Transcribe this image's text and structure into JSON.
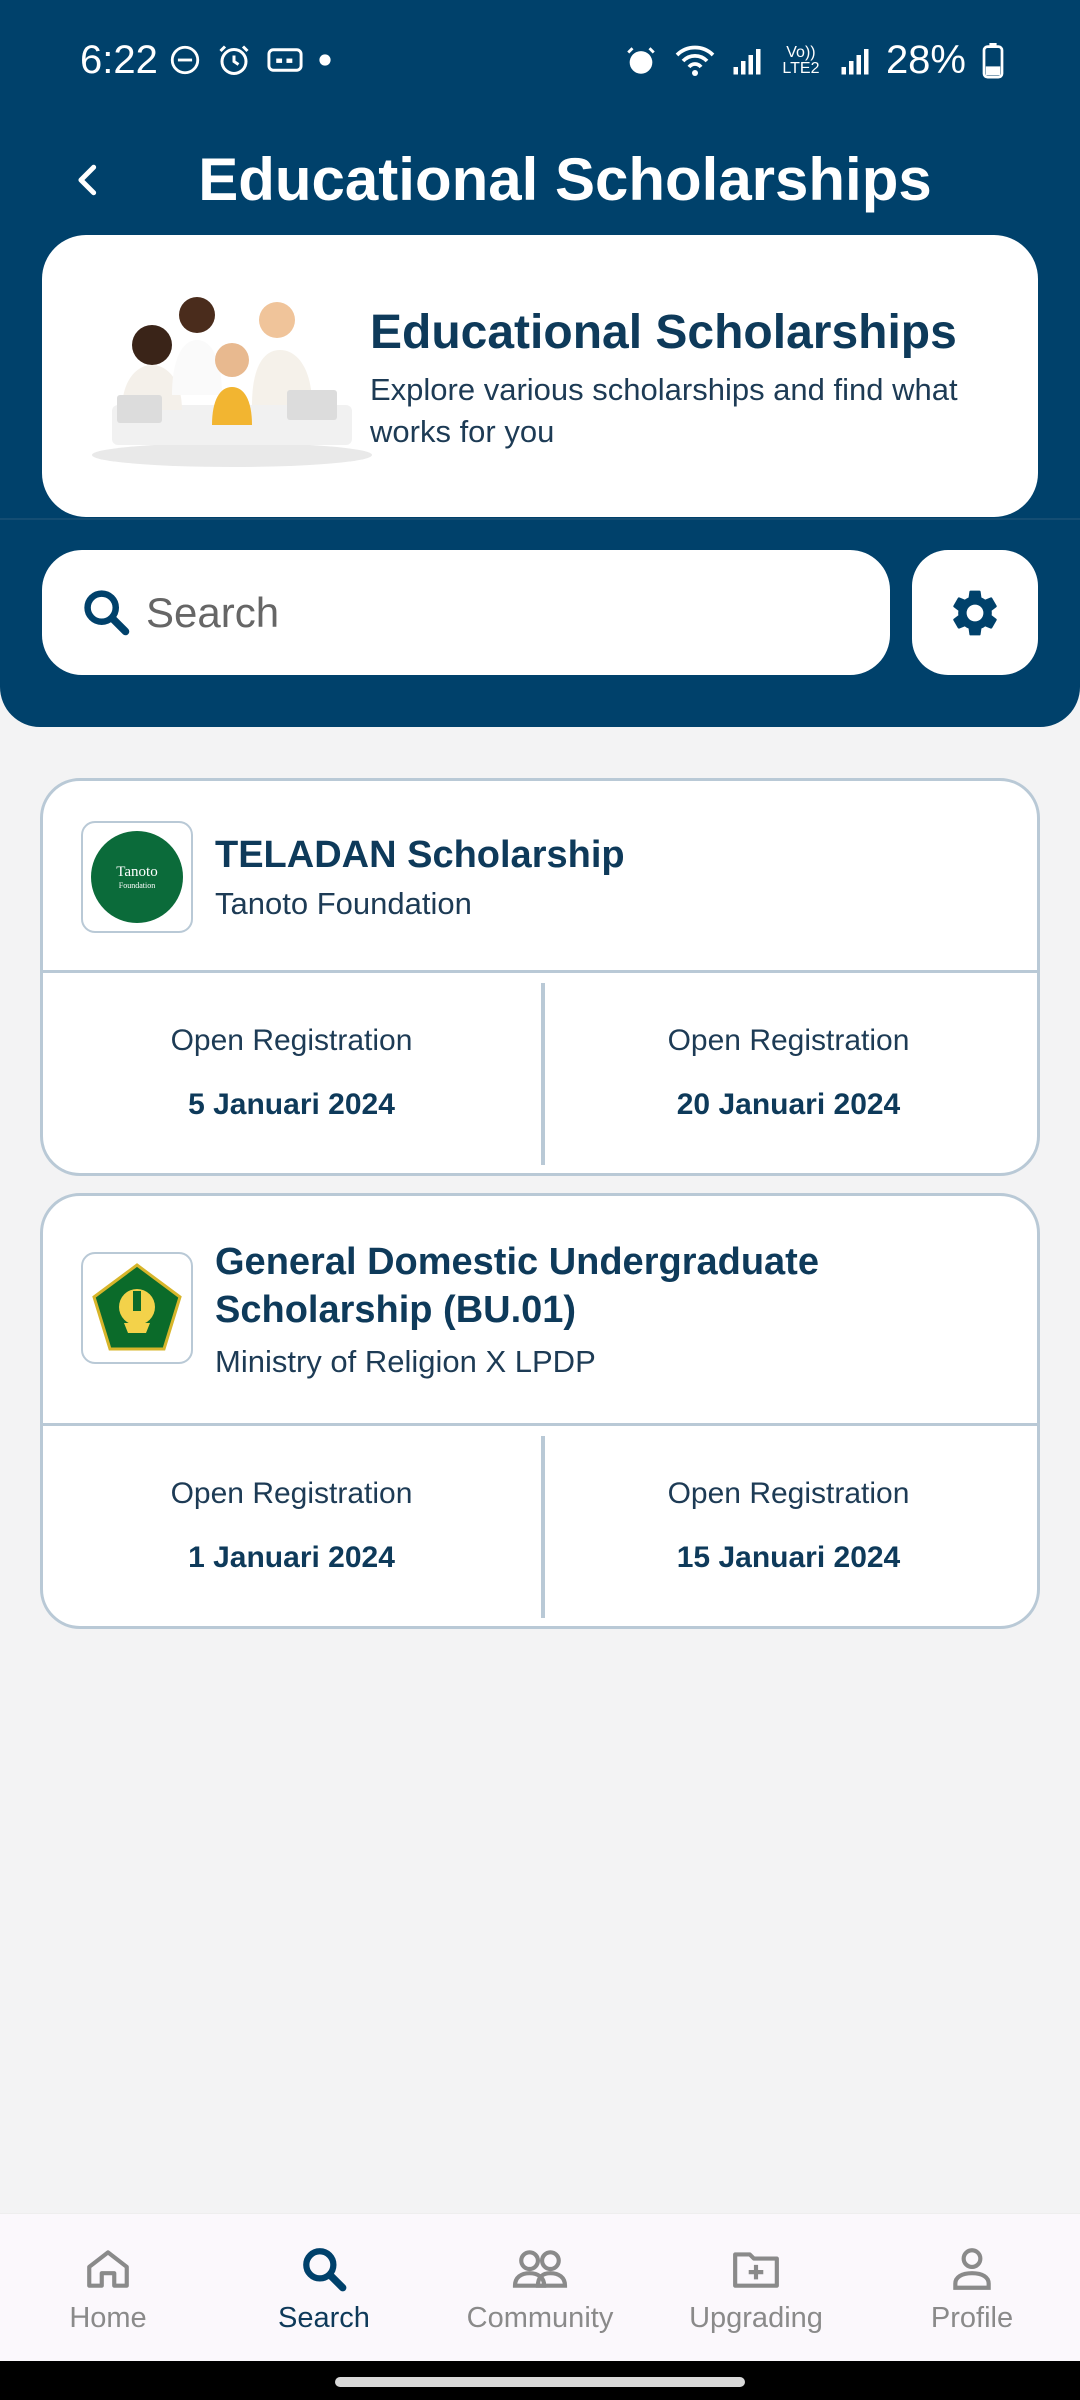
{
  "status_bar": {
    "time": "6:22",
    "battery": "28%",
    "network_label": "Vo)) LTE2"
  },
  "app_bar": {
    "title": "Educational Scholarships"
  },
  "hero": {
    "title": "Educational Scholarships",
    "subtitle": "Explore various scholarships and find what works for you"
  },
  "search": {
    "placeholder": "Search"
  },
  "scholarships": [
    {
      "title": "TELADAN Scholarship",
      "organization": "Tanoto Foundation",
      "logo_text": "Tanoto Foundation",
      "open_label_1": "Open Registration",
      "date_1": "5 Januari 2024",
      "open_label_2": "Open Registration",
      "date_2": "20 Januari 2024"
    },
    {
      "title": "General Domestic Undergraduate Scholarship (BU.01)",
      "organization": "Ministry of Religion X LPDP",
      "open_label_1": "Open Registration",
      "date_1": "1 Januari 2024",
      "open_label_2": "Open Registration",
      "date_2": "15 Januari 2024"
    }
  ],
  "bottom_nav": [
    {
      "label": "Home",
      "icon": "home-icon",
      "active": false
    },
    {
      "label": "Search",
      "icon": "search-icon",
      "active": true
    },
    {
      "label": "Community",
      "icon": "community-icon",
      "active": false
    },
    {
      "label": "Upgrading",
      "icon": "folder-plus-icon",
      "active": false
    },
    {
      "label": "Profile",
      "icon": "profile-icon",
      "active": false
    }
  ],
  "colors": {
    "primary": "#00416b",
    "title_text": "#0e3a5a",
    "border": "#b9c9d6",
    "background": "#f3f3f4"
  }
}
